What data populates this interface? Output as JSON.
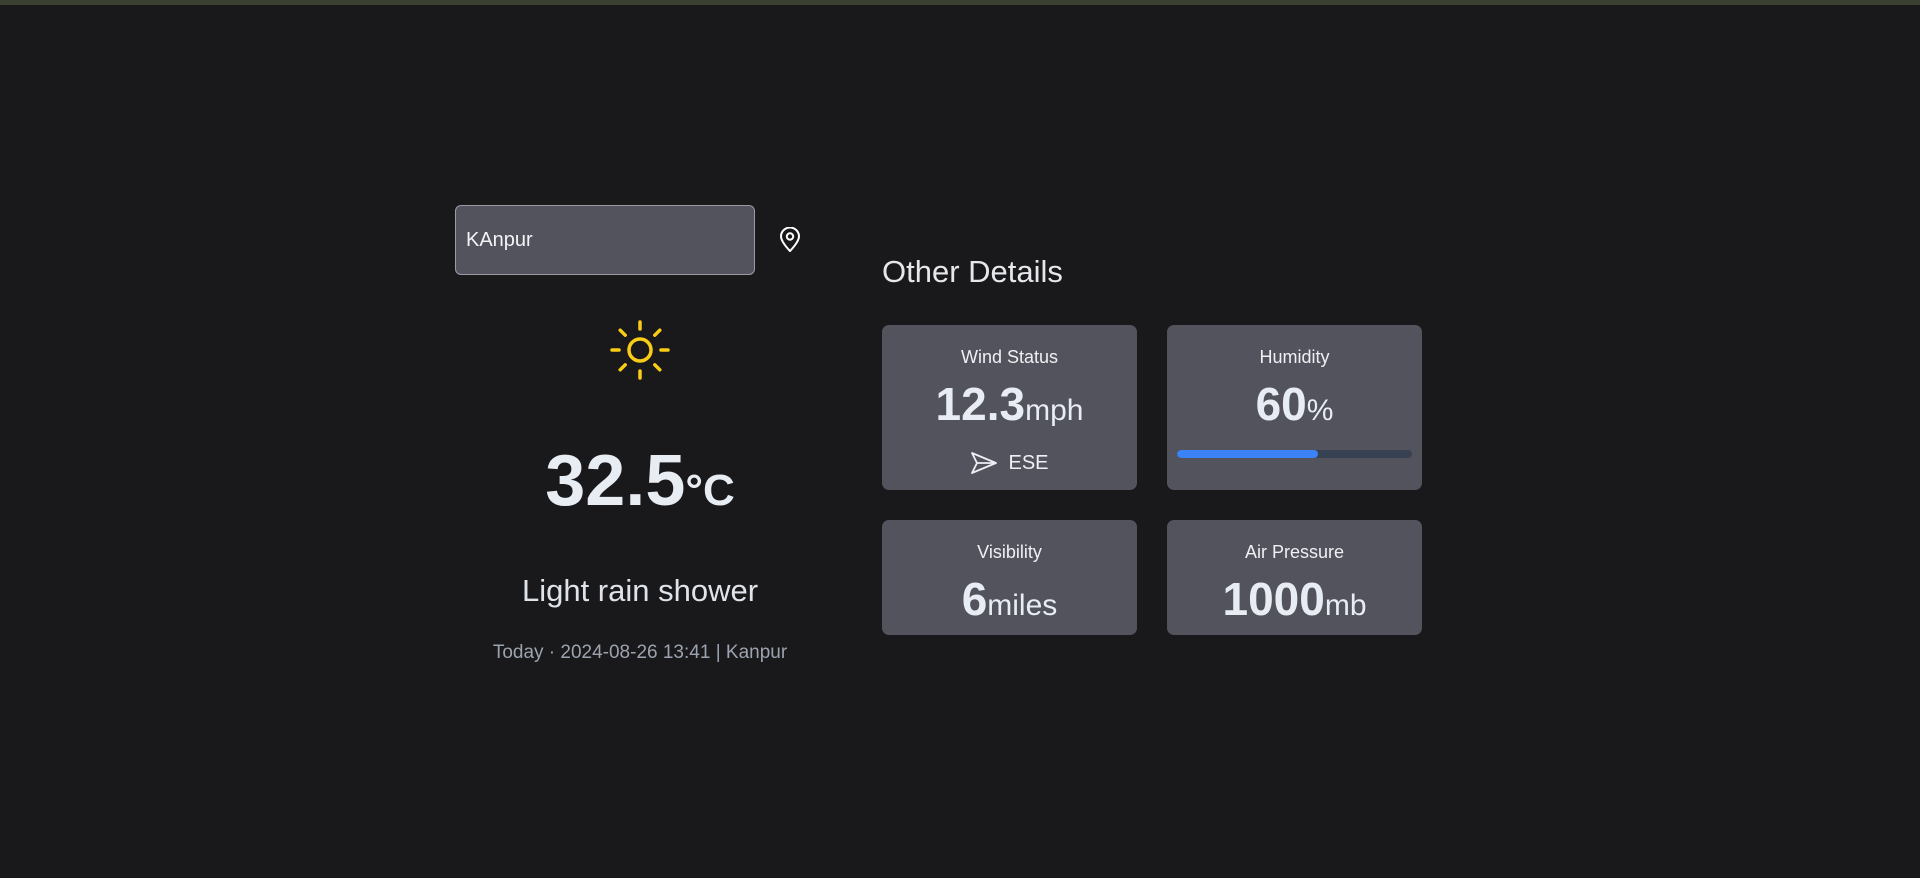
{
  "search": {
    "value": "KAnpur"
  },
  "current": {
    "icon": "sun-icon",
    "temperature": "32.5",
    "unit": "°C",
    "condition": "Light rain shower",
    "meta": "Today · 2024-08-26 13:41 | Kanpur"
  },
  "details": {
    "title": "Other Details",
    "wind": {
      "label": "Wind Status",
      "value": "12.3",
      "unit": "mph",
      "direction": "ESE",
      "direction_icon": "navigation-arrow-icon"
    },
    "humidity": {
      "label": "Humidity",
      "value": "60",
      "unit": "%",
      "percent": 60
    },
    "visibility": {
      "label": "Visibility",
      "value": "6",
      "unit": "miles"
    },
    "pressure": {
      "label": "Air Pressure",
      "value": "1000",
      "unit": "mb"
    }
  },
  "colors": {
    "background": "#19191b",
    "card": "#52535c",
    "accent": "#3b82f6",
    "sun": "#facc15"
  }
}
